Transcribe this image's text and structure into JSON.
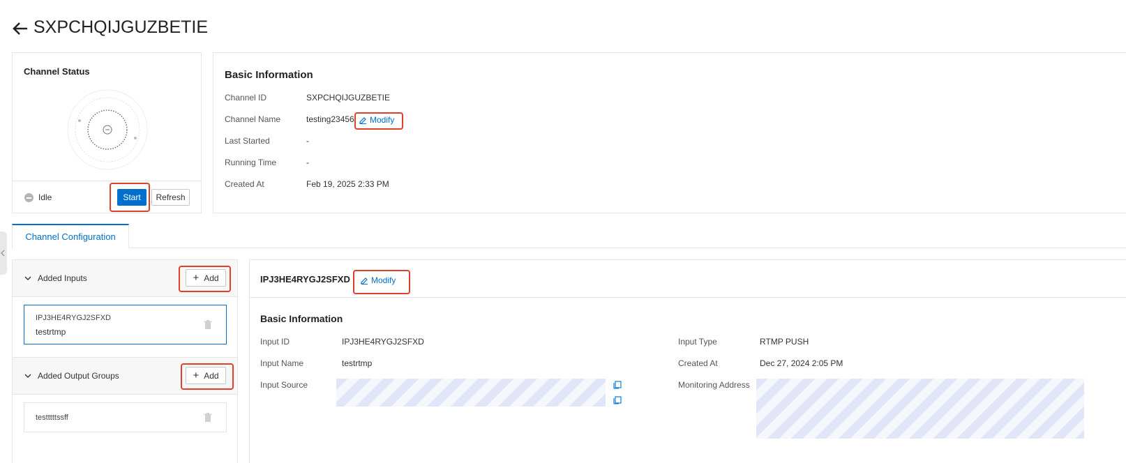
{
  "header": {
    "title": "SXPCHQIJGUZBETIE"
  },
  "status_card": {
    "title": "Channel Status",
    "state": "Idle",
    "start_label": "Start",
    "refresh_label": "Refresh"
  },
  "basic_info": {
    "title": "Basic Information",
    "channel_id_label": "Channel ID",
    "channel_id": "SXPCHQIJGUZBETIE",
    "channel_name_label": "Channel Name",
    "channel_name": "testing23456",
    "modify_label": "Modify",
    "last_started_label": "Last Started",
    "last_started": "-",
    "running_time_label": "Running Time",
    "running_time": "-",
    "created_at_label": "Created At",
    "created_at": "Feb 19, 2025 2:33 PM"
  },
  "tabs": [
    {
      "label": "Channel Configuration",
      "active": true
    }
  ],
  "inputs_panel": {
    "title": "Added Inputs",
    "add_label": "Add",
    "items": [
      {
        "id": "IPJ3HE4RYGJ2SFXD",
        "name": "testrtmp"
      }
    ]
  },
  "outputs_panel": {
    "title": "Added Output Groups",
    "add_label": "Add",
    "items": [
      {
        "name": "testttttssff"
      }
    ]
  },
  "input_detail": {
    "id_title": "IPJ3HE4RYGJ2SFXD",
    "modify_label": "Modify",
    "section_title": "Basic Information",
    "input_id_label": "Input ID",
    "input_id": "IPJ3HE4RYGJ2SFXD",
    "input_name_label": "Input Name",
    "input_name": "testrtmp",
    "input_source_label": "Input Source",
    "input_type_label": "Input Type",
    "input_type": "RTMP PUSH",
    "created_at_label": "Created At",
    "created_at": "Dec 27, 2024 2:05 PM",
    "monitoring_label": "Monitoring Address"
  },
  "colors": {
    "primary": "#0070cc",
    "highlight": "#e0402a"
  }
}
